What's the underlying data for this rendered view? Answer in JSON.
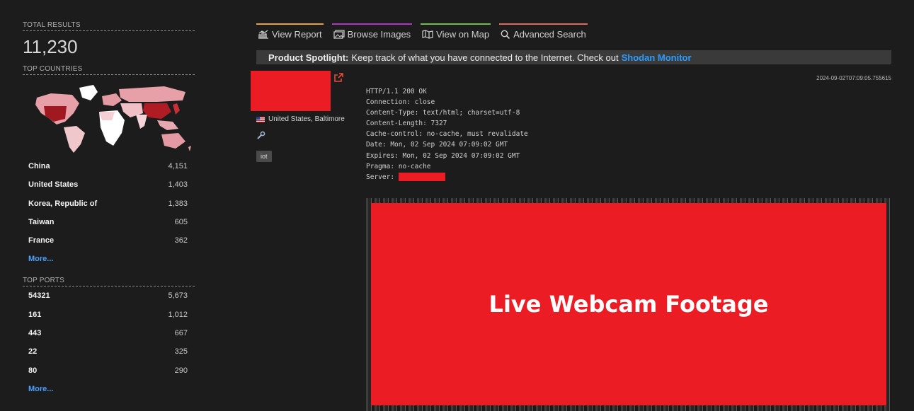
{
  "sidebar": {
    "total_results_label": "TOTAL RESULTS",
    "total_results": "11,230",
    "top_countries_label": "TOP COUNTRIES",
    "countries": [
      {
        "name": "China",
        "count": "4,151"
      },
      {
        "name": "United States",
        "count": "1,403"
      },
      {
        "name": "Korea, Republic of",
        "count": "1,383"
      },
      {
        "name": "Taiwan",
        "count": "605"
      },
      {
        "name": "France",
        "count": "362"
      }
    ],
    "more_label": "More...",
    "top_ports_label": "TOP PORTS",
    "ports": [
      {
        "name": "54321",
        "count": "5,673"
      },
      {
        "name": "161",
        "count": "1,012"
      },
      {
        "name": "443",
        "count": "667"
      },
      {
        "name": "22",
        "count": "325"
      },
      {
        "name": "80",
        "count": "290"
      }
    ]
  },
  "tabs": [
    {
      "label": "View Report",
      "color": "#e8a13a"
    },
    {
      "label": "Browse Images",
      "color": "#b034c8"
    },
    {
      "label": "View on Map",
      "color": "#6cc04a"
    },
    {
      "label": "Advanced Search",
      "color": "#e0685a"
    }
  ],
  "spotlight": {
    "prefix": "Product Spotlight:",
    "text": "Keep track of what you have connected to the Internet. Check out",
    "link": "Shodan Monitor"
  },
  "result": {
    "location": "United States, Baltimore",
    "tag": "iot",
    "timestamp": "2024-09-02T07:09:05.755615",
    "banner_lines": [
      "HTTP/1.1 200 OK",
      "Connection: close",
      "Content-Type: text/html; charset=utf-8",
      "Content-Length: 7327",
      "Cache-control: no-cache, must revalidate",
      "Date: Mon, 02 Sep 2024 07:09:02 GMT",
      "Expires: Mon, 02 Sep 2024 07:09:02 GMT",
      "Pragma: no-cache"
    ],
    "server_label": "Server:",
    "footage_label": "Live Webcam Footage"
  },
  "colors": {
    "redaction": "#ec1c24",
    "link": "#4aa0ff"
  }
}
